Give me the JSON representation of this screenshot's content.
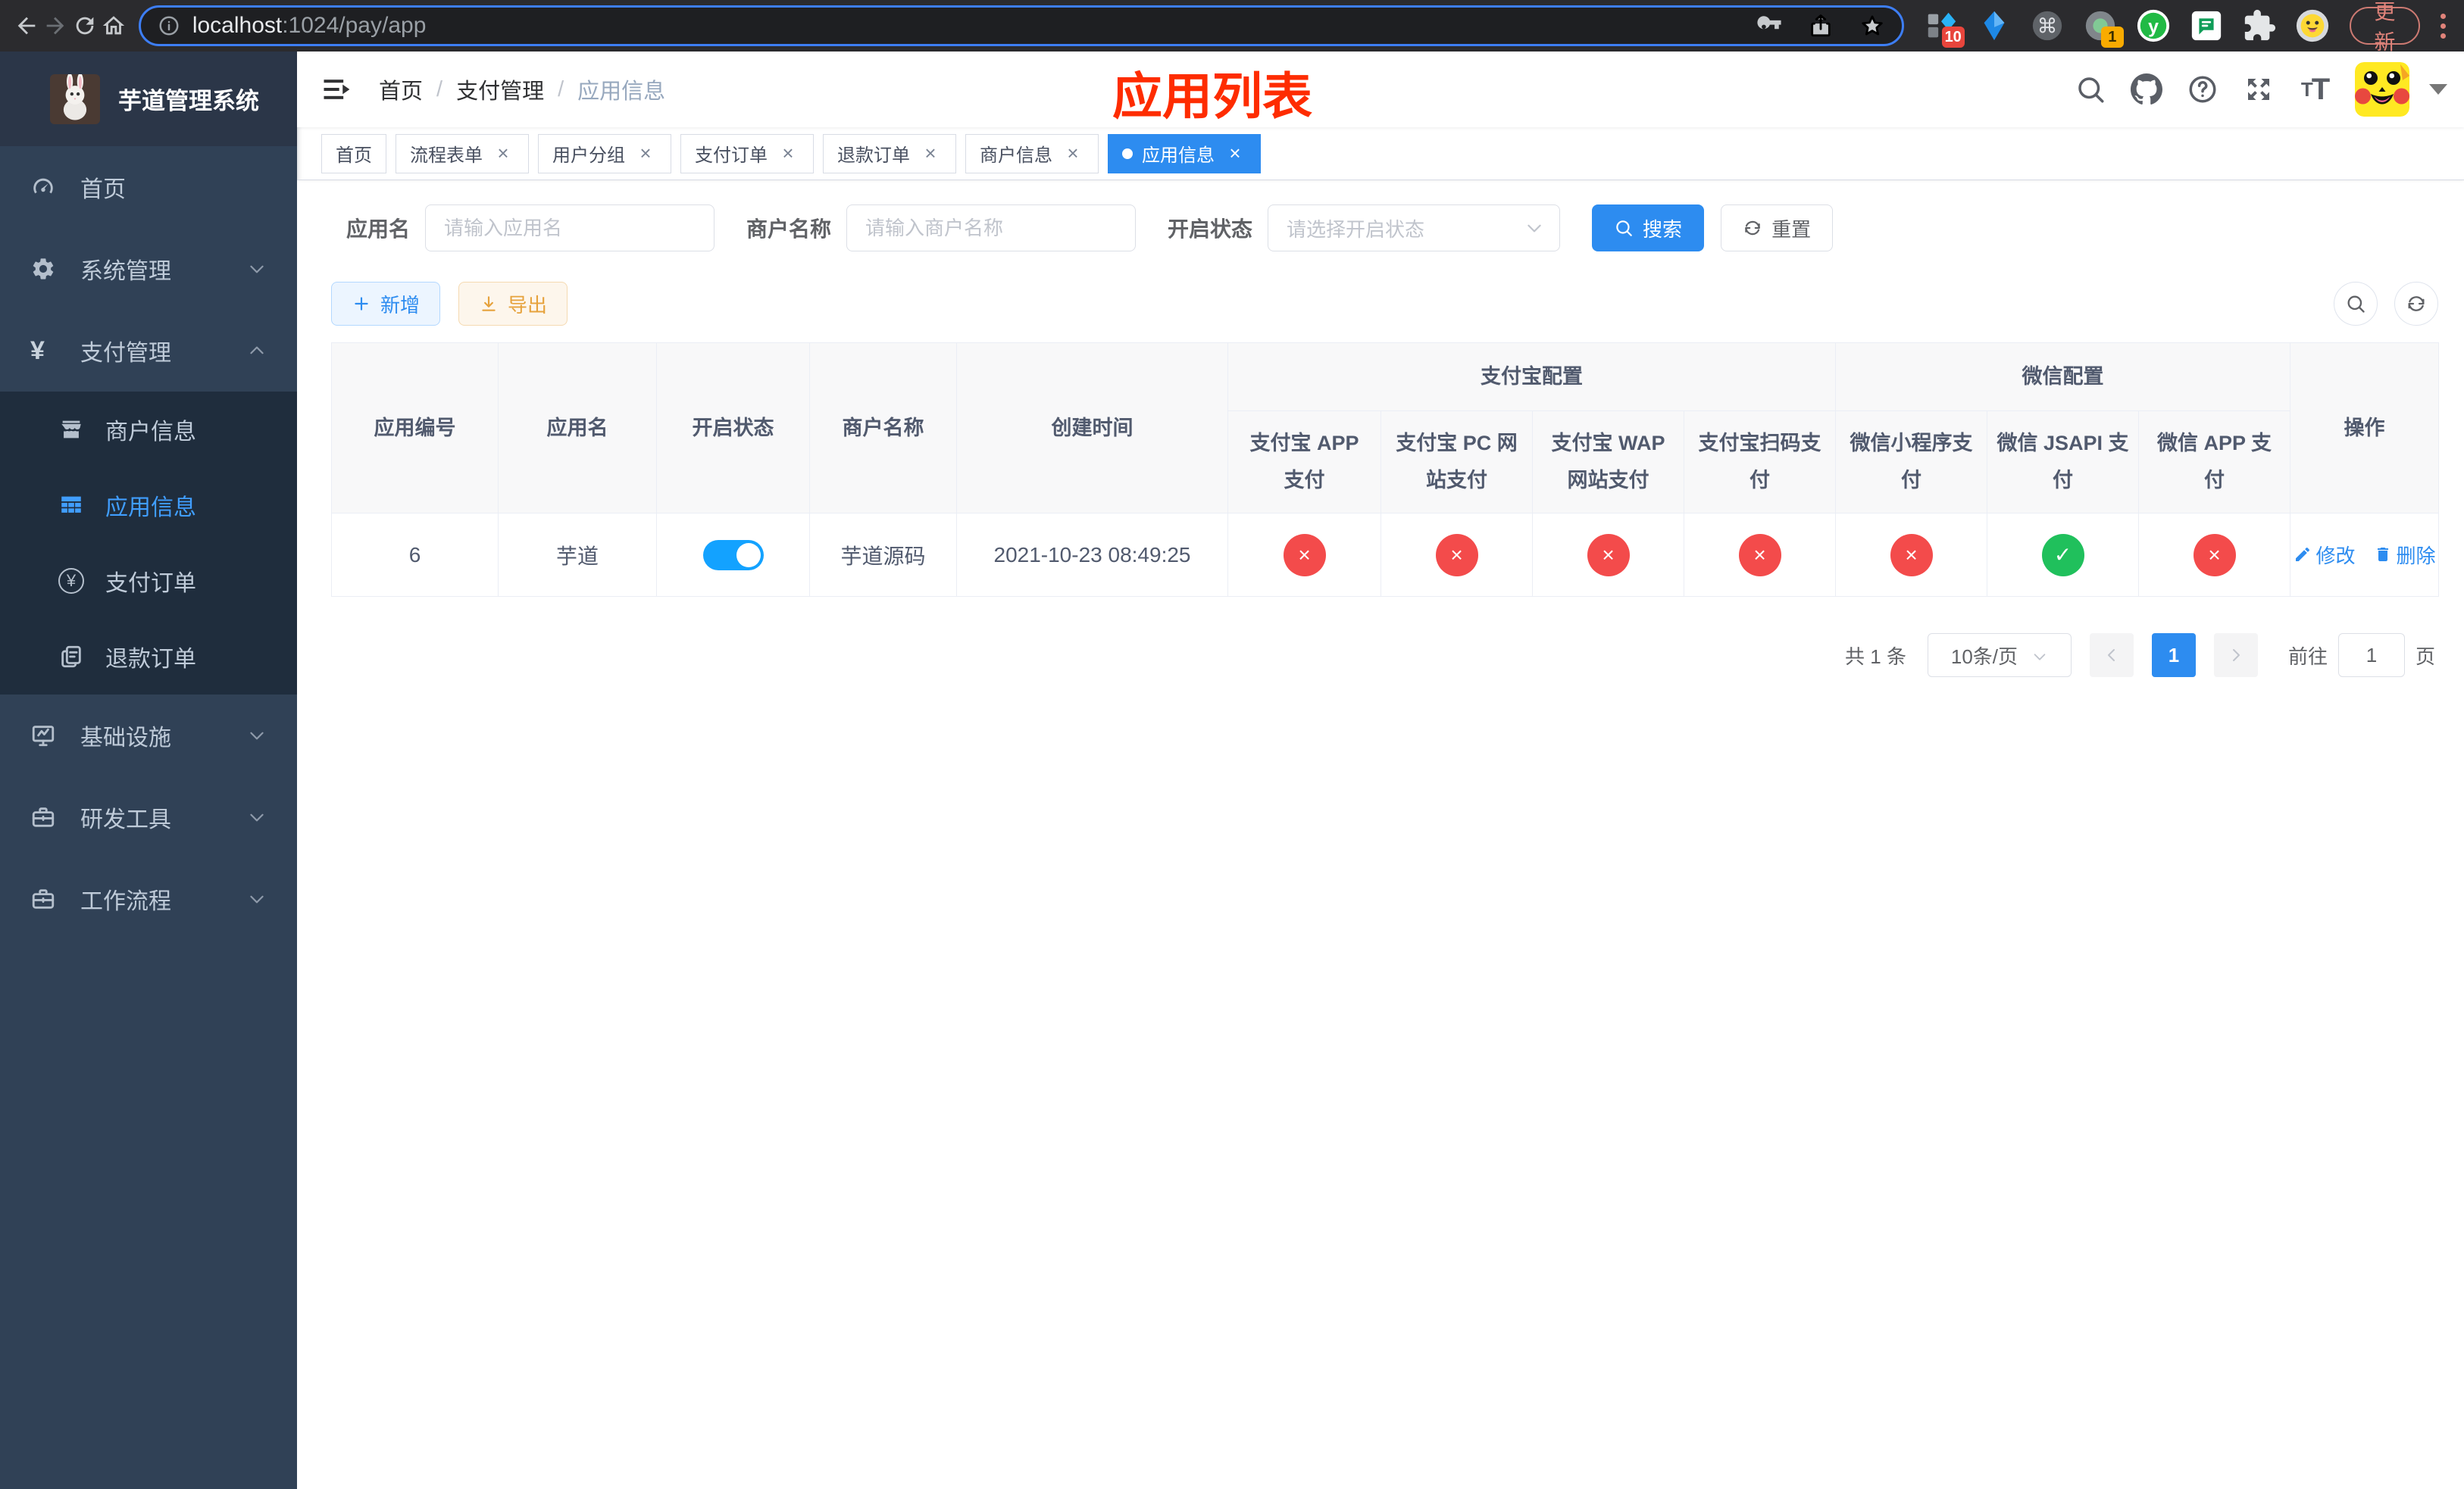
{
  "browser": {
    "url_host": "localhost",
    "url_path": ":1024/pay/app",
    "update_label": "更新",
    "ext_badge_blue": "10",
    "ext_badge_orange": "1"
  },
  "sidebar": {
    "logo_title": "芋道管理系统",
    "items": [
      {
        "label": "首页"
      },
      {
        "label": "系统管理"
      },
      {
        "label": "支付管理",
        "children": [
          {
            "label": "商户信息"
          },
          {
            "label": "应用信息"
          },
          {
            "label": "支付订单"
          },
          {
            "label": "退款订单"
          }
        ]
      },
      {
        "label": "基础设施"
      },
      {
        "label": "研发工具"
      },
      {
        "label": "工作流程"
      }
    ]
  },
  "header": {
    "breadcrumb": [
      "首页",
      "支付管理",
      "应用信息"
    ],
    "title": "应用列表"
  },
  "tabs": [
    {
      "label": "首页"
    },
    {
      "label": "流程表单"
    },
    {
      "label": "用户分组"
    },
    {
      "label": "支付订单"
    },
    {
      "label": "退款订单"
    },
    {
      "label": "商户信息"
    },
    {
      "label": "应用信息"
    }
  ],
  "filters": {
    "app_name_label": "应用名",
    "app_name_placeholder": "请输入应用名",
    "merchant_label": "商户名称",
    "merchant_placeholder": "请输入商户名称",
    "status_label": "开启状态",
    "status_placeholder": "请选择开启状态",
    "search_label": "搜索",
    "reset_label": "重置"
  },
  "toolbar": {
    "add_label": "新增",
    "export_label": "导出"
  },
  "table": {
    "columns": {
      "app_id": "应用编号",
      "app_name": "应用名",
      "status": "开启状态",
      "merchant": "商户名称",
      "created": "创建时间",
      "alipay_group": "支付宝配置",
      "wechat_group": "微信配置",
      "actions": "操作",
      "channels": [
        "支付宝 APP 支付",
        "支付宝 PC 网站支付",
        "支付宝 WAP 网站支付",
        "支付宝扫码支付",
        "微信小程序支付",
        "微信 JSAPI 支付",
        "微信 APP 支付"
      ]
    },
    "rows": [
      {
        "app_id": "6",
        "app_name": "芋道",
        "status_enabled": true,
        "merchant": "芋道源码",
        "created": "2021-10-23 08:49:25",
        "channels": [
          "disabled",
          "disabled",
          "disabled",
          "disabled",
          "disabled",
          "enabled",
          "disabled"
        ],
        "edit_label": "修改",
        "delete_label": "删除"
      }
    ]
  },
  "pagination": {
    "total": "共 1 条",
    "page_size": "10条/页",
    "page": "1",
    "goto_label": "前往",
    "goto_value": "1",
    "unit": "页"
  },
  "icons": {
    "close": "×",
    "check": "✓",
    "cross": "×",
    "separator": "/"
  },
  "colors": {
    "accent": "#2d8cf0",
    "sidebar_active": "#409eff",
    "success": "#20c05c",
    "danger": "#f34b4b",
    "title_red": "#fe2c00"
  }
}
